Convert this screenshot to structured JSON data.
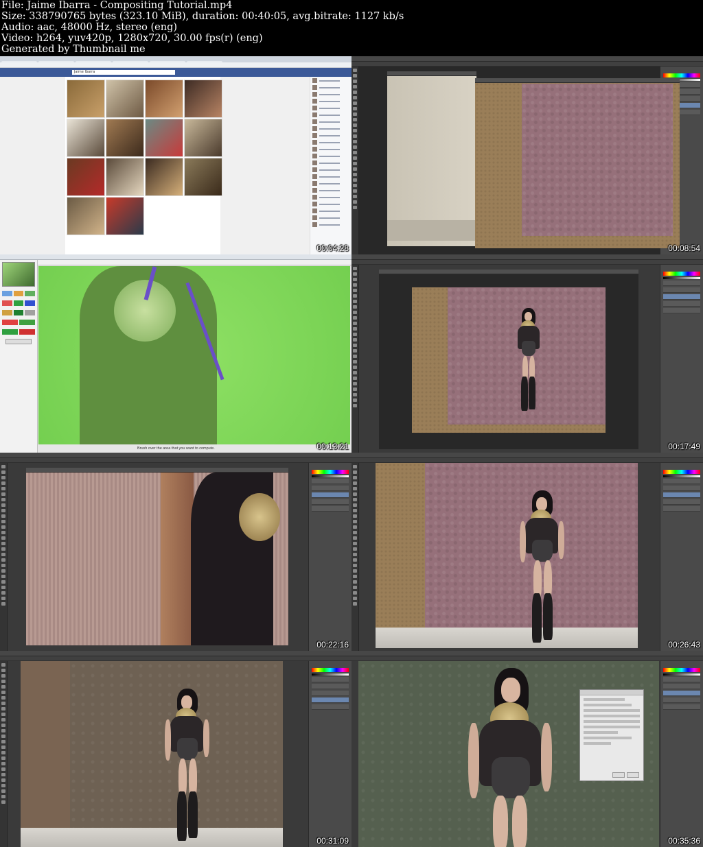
{
  "header": {
    "file": "File: Jaime Ibarra - Compositing Tutorial.mp4",
    "size": "Size: 338790765 bytes (323.10 MiB), duration: 00:40:05, avg.bitrate: 1127 kb/s",
    "audio": "Audio: aac, 48000 Hz, stereo (eng)",
    "video": "Video: h264, yuv420p, 1280x720, 30.00 fps(r) (eng)",
    "generated": "Generated by Thumbnail me"
  },
  "thumbnails": [
    {
      "timestamp": "00:04:28"
    },
    {
      "timestamp": "00:08:54"
    },
    {
      "timestamp": "00:13:21"
    },
    {
      "timestamp": "00:17:49"
    },
    {
      "timestamp": "00:22:16"
    },
    {
      "timestamp": "00:26:43"
    },
    {
      "timestamp": "00:31:09"
    },
    {
      "timestamp": "00:35:36"
    }
  ],
  "browser": {
    "profile_name": "Jaime Ibarra"
  },
  "fluid_mask": {
    "status_hint": "Brush over the area that you want to compute."
  },
  "colors": {
    "photoshop_bg": "#3a3a3a",
    "facebook_blue": "#3b5998",
    "green_screen": "#7ed957"
  }
}
